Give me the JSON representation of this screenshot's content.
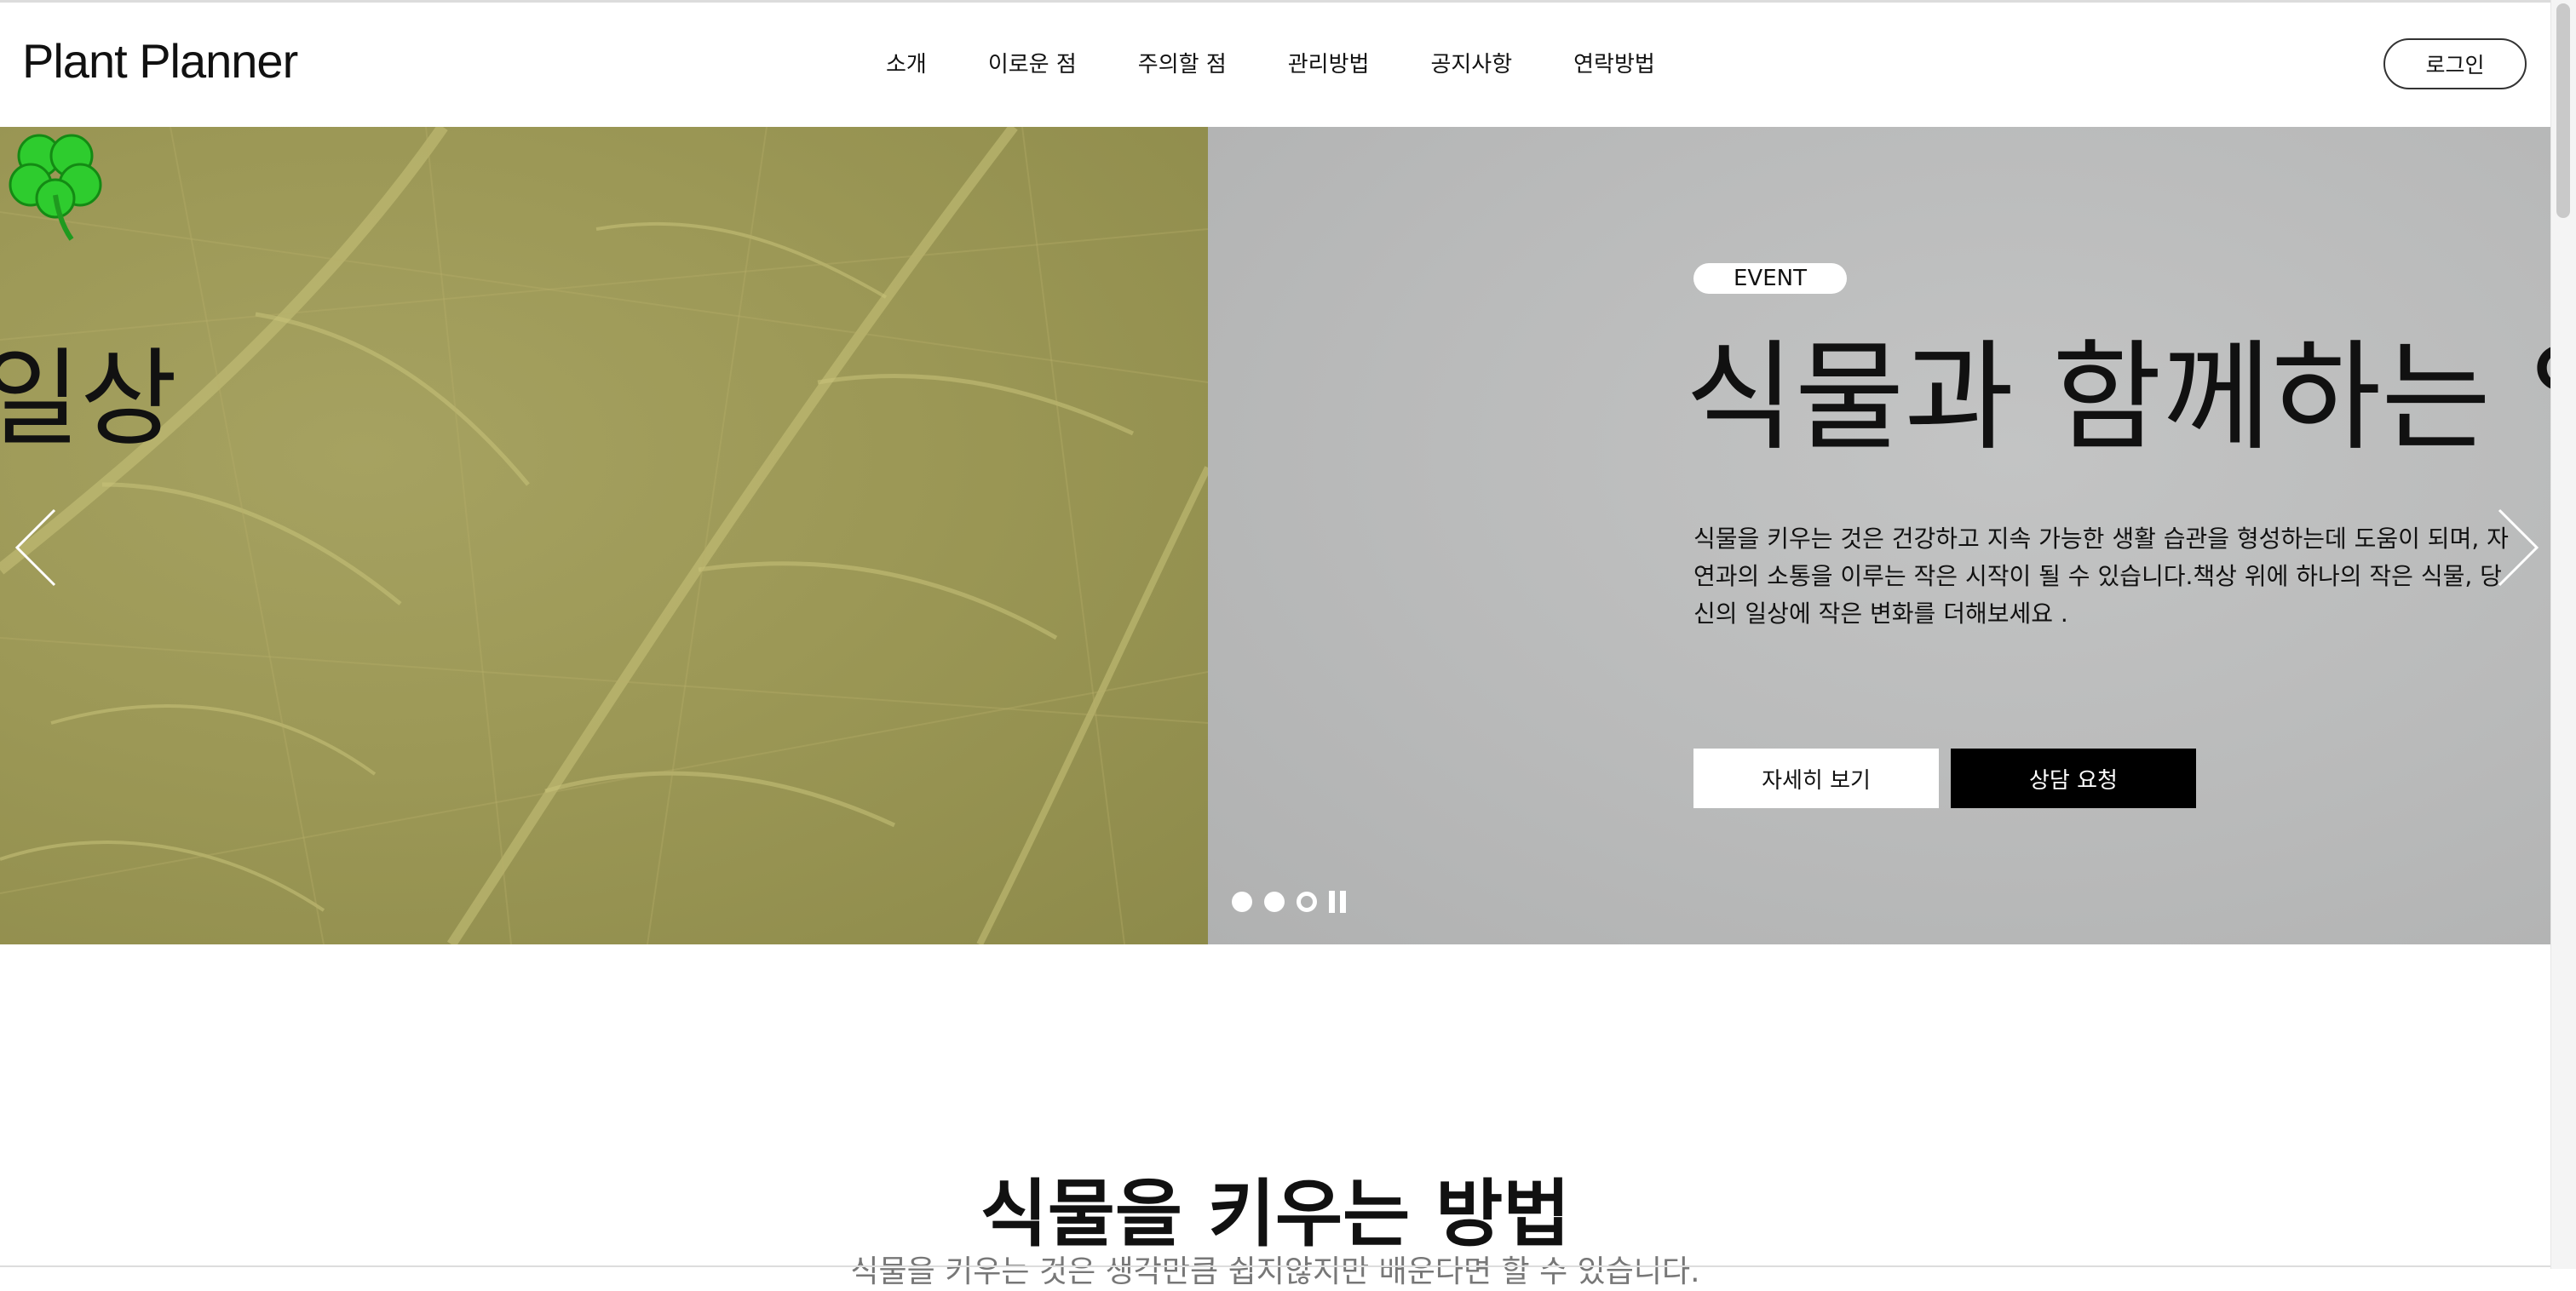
{
  "header": {
    "logo": "Plant Planner",
    "nav": [
      "소개",
      "이로운 점",
      "주의할 점",
      "관리방법",
      "공지사항",
      "연락방법"
    ],
    "login_label": "로그인"
  },
  "hero": {
    "left_title": "일상",
    "badge": "EVENT",
    "title": "식물과 함께하는 일",
    "description": "식물을 키우는 것은 건강하고 지속 가능한 생활 습관을 형성하는데 도움이 되며, 자연과의 소통을 이루는 작은 시작이 될 수 있습니다.책상 위에 하나의 작은 식물, 당신의 일상에 작은 변화를 더해보세요 .",
    "btn_more": "자세히 보기",
    "btn_consult": "상담 요청",
    "left_bg_color": "#9c9856",
    "right_bg_color": "#b9baba",
    "slide_count": 3,
    "active_slide": 3
  },
  "section": {
    "title": "식물을 키우는 방법",
    "subtitle": "식물을 키우는 것은 생각만큼 쉽지않지만 배운다면 할 수 있습니다."
  },
  "icons": {
    "clover": "clover-icon",
    "prev": "chevron-left-icon",
    "next": "chevron-right-icon",
    "pause": "pause-icon"
  }
}
